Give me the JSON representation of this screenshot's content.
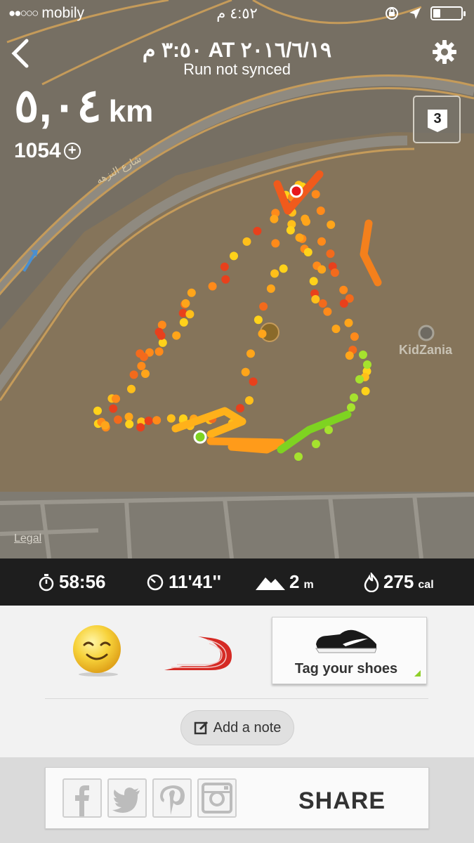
{
  "status_bar": {
    "carrier": "mobily",
    "signal_dots": "●●○○○",
    "time": "٤:٥٢ م",
    "battery_level": 0.25
  },
  "header": {
    "title": "٣:٥٠ م AT ٢٠١٦/٦/١٩",
    "subtitle": "Run not synced"
  },
  "summary": {
    "distance_value": "٥,٠٤",
    "distance_unit": "km",
    "nikefuel": "1054",
    "laps": "3"
  },
  "map": {
    "street_label": "شارع النزهه",
    "poi_label": "KidZania",
    "legal": "Legal",
    "route_start_color": "#7ed321",
    "route_end_color": "#e8161b"
  },
  "stats": {
    "duration": "58:56",
    "pace": "11'41''",
    "elevation_value": "2",
    "elevation_unit": "m",
    "calories_value": "275",
    "calories_unit": "cal"
  },
  "actions": {
    "mood_icon": "smiley-face-icon",
    "terrain_icon": "track-icon",
    "tag_shoes": "Tag your shoes",
    "add_note": "Add a note",
    "share": "SHARE",
    "share_targets": [
      "facebook-icon",
      "twitter-icon",
      "pinterest-icon",
      "instagram-icon"
    ]
  },
  "colors": {
    "stats_bar": "#1e1e1e",
    "accent_green": "#8fcf2a",
    "map_base": "#7a7468"
  }
}
